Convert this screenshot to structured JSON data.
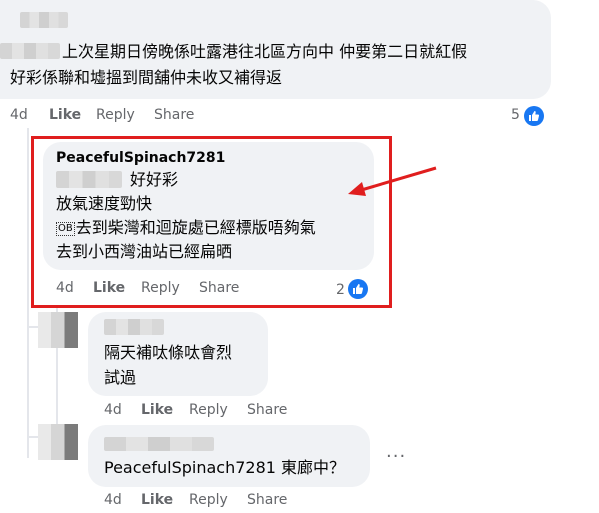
{
  "comment1": {
    "line1": "上次星期日傍晚係吐露港往北區方向中 仲要第二日就紅假",
    "line2": "好彩係聯和墟搵到間舖仲未收又補得返",
    "time": "4d",
    "like": "Like",
    "reply": "Reply",
    "share": "Share",
    "likes": "5"
  },
  "comment2": {
    "author": "PeacefulSpinach7281",
    "line1": "好好彩",
    "line2": "放氣速度勁快",
    "line3_badge": "OB",
    "line3": "去到柴灣和迴旋處已經標版唔夠氣",
    "line4": "去到小西灣油站已經扁晒",
    "time": "4d",
    "like": "Like",
    "reply": "Reply",
    "share": "Share",
    "likes": "2"
  },
  "comment3": {
    "line1": "隔天補呔條呔會烈",
    "line2": "試過",
    "time": "4d",
    "like": "Like",
    "reply": "Reply",
    "share": "Share"
  },
  "comment4": {
    "text": "PeacefulSpinach7281 東廊中？",
    "time": "4d",
    "like": "Like",
    "reply": "Reply",
    "share": "Share",
    "more": "···"
  },
  "colors": {
    "bubble": "#f0f2f5",
    "highlight": "#e01e1e",
    "like_blue": "#1877f2",
    "meta_gray": "#65676b"
  }
}
